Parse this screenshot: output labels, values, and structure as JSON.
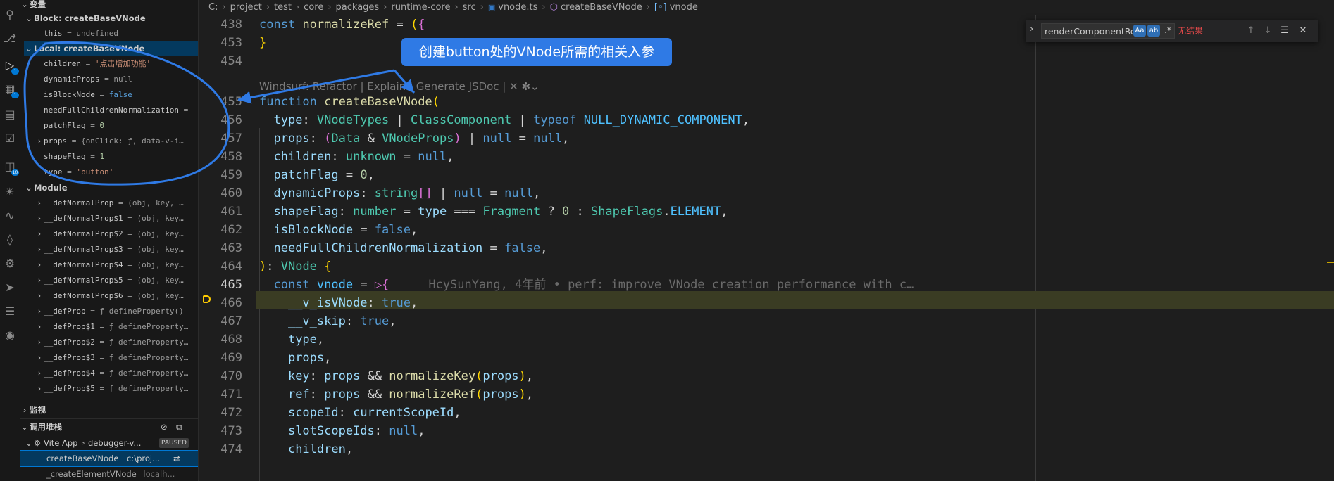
{
  "breadcrumb": [
    "C:",
    "project",
    "test",
    "core",
    "packages",
    "runtime-core",
    "src",
    "vnode.ts",
    "createBaseVNode",
    "vnode"
  ],
  "side": {
    "variables_header": "变量",
    "block_header": "Block: createBaseVNode",
    "block_vars": [
      {
        "name": "this",
        "value": "undefined"
      }
    ],
    "local_header": "Local: createBaseVNode",
    "local_vars": [
      {
        "name": "children",
        "value": "'点击增加功能'",
        "kind": "str"
      },
      {
        "name": "dynamicProps",
        "value": "null",
        "kind": "plain"
      },
      {
        "name": "isBlockNode",
        "value": "false",
        "kind": "kw"
      },
      {
        "name": "needFullChildrenNormalization",
        "value": "",
        "kind": "plain"
      },
      {
        "name": "patchFlag",
        "value": "0",
        "kind": "num"
      },
      {
        "name": "props",
        "value": "{onClick: ƒ, data-v-i…",
        "kind": "plain",
        "expandable": true
      },
      {
        "name": "shapeFlag",
        "value": "1",
        "kind": "num"
      },
      {
        "name": "type",
        "value": "'button'",
        "kind": "str"
      }
    ],
    "module_header": "Module",
    "module_vars": [
      {
        "name": "__defNormalProp",
        "value": "(obj, key, …"
      },
      {
        "name": "__defNormalProp$1",
        "value": "(obj, key…"
      },
      {
        "name": "__defNormalProp$2",
        "value": "(obj, key…"
      },
      {
        "name": "__defNormalProp$3",
        "value": "(obj, key…"
      },
      {
        "name": "__defNormalProp$4",
        "value": "(obj, key…"
      },
      {
        "name": "__defNormalProp$5",
        "value": "(obj, key…"
      },
      {
        "name": "__defNormalProp$6",
        "value": "(obj, key…"
      },
      {
        "name": "__defProp",
        "value": "ƒ defineProperty()"
      },
      {
        "name": "__defProp$1",
        "value": "ƒ defineProperty…"
      },
      {
        "name": "__defProp$2",
        "value": "ƒ defineProperty…"
      },
      {
        "name": "__defProp$3",
        "value": "ƒ defineProperty…"
      },
      {
        "name": "__defProp$4",
        "value": "ƒ defineProperty…"
      },
      {
        "name": "__defProp$5",
        "value": "ƒ defineProperty…"
      }
    ],
    "watch_header": "监视",
    "callstack_header": "调用堆栈",
    "session_name": "Vite App ∘ debugger-v...",
    "session_status": "PAUSED",
    "frames": [
      {
        "name": "createBaseVNode",
        "location": "c:\\proj..."
      },
      {
        "name": "_createElementVNode",
        "location": "localh..."
      }
    ]
  },
  "editor": {
    "codelens": "Windsurf: Refactor | Explain | Generate JSDoc | ✕",
    "current_line": "465",
    "blame": "HcySunYang, 4年前 • perf: improve VNode creation performance with c…",
    "line_numbers": [
      "438",
      "453",
      "454",
      "455",
      "456",
      "457",
      "458",
      "459",
      "460",
      "461",
      "462",
      "463",
      "464",
      "465",
      "466",
      "467",
      "468",
      "469",
      "470",
      "471",
      "472",
      "473",
      "474"
    ]
  },
  "find": {
    "value": "renderComponentRo",
    "case_label": "Aa",
    "word_label": "ab",
    "regex_label": ".*",
    "no_results": "无结果"
  },
  "annotation": {
    "callout": "创建button处的VNode所需的相关入参",
    "accent_color": "#2f7ae5"
  }
}
